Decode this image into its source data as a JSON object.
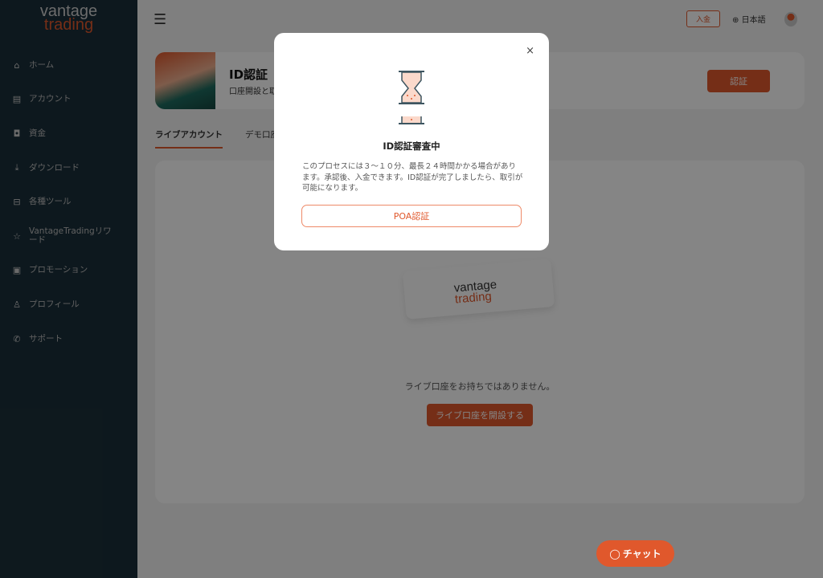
{
  "sidebar": {
    "logo_top": "vantage",
    "logo_bottom": "trading",
    "items": [
      {
        "label": "ホーム",
        "icon": "home-icon"
      },
      {
        "label": "アカウント",
        "icon": "account-icon"
      },
      {
        "label": "資金",
        "icon": "wallet-icon"
      },
      {
        "label": "ダウンロード",
        "icon": "download-icon"
      },
      {
        "label": "各種ツール",
        "icon": "toolbox-icon"
      },
      {
        "label": "VantageTradingリワード",
        "icon": "rewards-basket-icon"
      },
      {
        "label": "プロモーション",
        "icon": "gift-icon"
      },
      {
        "label": "プロフィール",
        "icon": "profile-icon"
      },
      {
        "label": "サポート",
        "icon": "phone-icon"
      }
    ]
  },
  "header": {
    "deposit": "入金",
    "language": "日本語"
  },
  "banner": {
    "title": "ID認証",
    "subtitle": "口座開設と取",
    "button": "認証"
  },
  "tabs": [
    {
      "label": "ライブアカウント",
      "active": true
    },
    {
      "label": "デモ口座",
      "active": false
    }
  ],
  "panel": {
    "card_logo_top": "vantage",
    "card_logo_bottom": "trading",
    "empty_text": "ライブ口座をお持ちではありません。",
    "open_button": "ライブ口座を開設する"
  },
  "chat": {
    "label": "チャット"
  },
  "modal": {
    "title": "ID認証審査中",
    "description": "このプロセスには３〜１０分、最長２４時間かかる場合があります。承認後、入金できます。ID認証が完了しましたら、取引が可能になります。",
    "button": "POA認証",
    "close": "×"
  },
  "colors": {
    "accent": "#e0582c",
    "sidebar": "#1a2f3a"
  }
}
